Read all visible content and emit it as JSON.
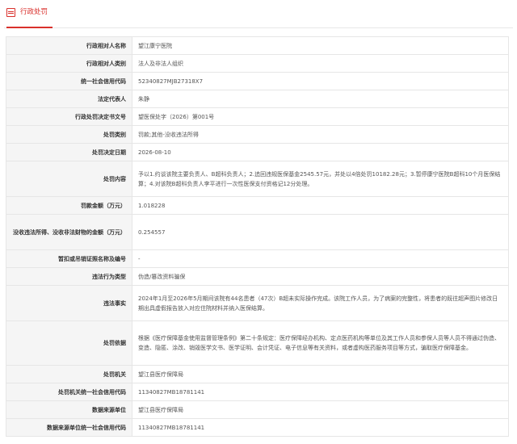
{
  "tab": {
    "label": "行政处罚"
  },
  "rows": [
    {
      "label": "行政相对人名称",
      "value": "望江康宁医院"
    },
    {
      "label": "行政相对人类别",
      "value": "法人及非法人组织"
    },
    {
      "label": "统一社会信用代码",
      "value": "52340827MJB27318X7"
    },
    {
      "label": "法定代表人",
      "value": "朱静"
    },
    {
      "label": "行政处罚决定书文号",
      "value": "望医保处字（2026）第001号"
    },
    {
      "label": "处罚类别",
      "value": "罚款;其他-没收违法所得"
    },
    {
      "label": "处罚决定日期",
      "value": "2026-08-10"
    },
    {
      "label": "处罚内容",
      "value": "予以1.约谈该院主要负责人、B超科负责人；2.追回违规医保基金2545.57元，并处以4倍处罚10182.28元；3.暂停康宁医院B超科10个月医保结算；4.对该院B超科负责人李平进行一次性医保支付资格记12分处理。"
    },
    {
      "label": "罚款金额（万元）",
      "value": "1.018228"
    },
    {
      "label": "没收违法所得、没收非法财物的金额（万元）",
      "value": "0.254557"
    },
    {
      "label": "暂扣或吊销证照名称及编号",
      "value": "-"
    },
    {
      "label": "违法行为类型",
      "value": "伪造/篡改资料骗保"
    },
    {
      "label": "违法事实",
      "value": "2024年1月至2026年5月期间该院有44名患者（47次）B超未实际操作完成。该院工作人员，为了病案的完整性，将患者的既往超声图片修改日期出具虚假报告放入对应住院材料并纳入医保结算。"
    },
    {
      "label": "处罚依据",
      "value": "根据《医疗保障基金使用监督管理条例》第二十条规定：医疗保障经办机构、定点医药机构等单位及其工作人员和参保人员等人员不得通过伪造、变造、隐匿、涂改、销毁医学文书、医学证明、会计凭证、电子信息等有关资料，或者虚构医药服务项目等方式，骗取医疗保障基金。"
    },
    {
      "label": "处罚机关",
      "value": "望江县医疗保障局"
    },
    {
      "label": "处罚机关统一社会信用代码",
      "value": "11340827MB18781141"
    },
    {
      "label": "数据来源单位",
      "value": "望江县医疗保障局"
    },
    {
      "label": "数据来源单位统一社会信用代码",
      "value": "11340827MB18781141"
    }
  ]
}
